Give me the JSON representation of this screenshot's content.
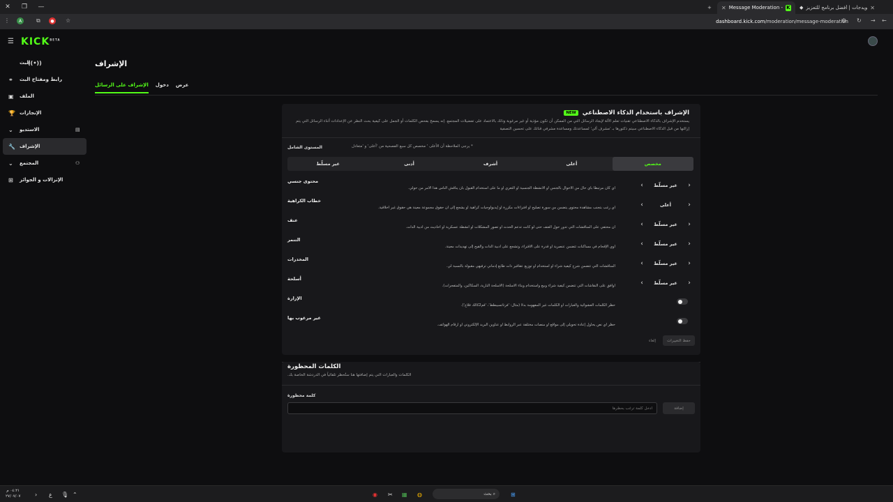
{
  "browser": {
    "tabs": [
      {
        "title": "الويدجات | أفضل برنامج للتعزيز ..."
      },
      {
        "title": "Message Moderation - Kick Da..."
      }
    ],
    "new_tab": "+",
    "url_host": "dashboard.kick.com",
    "url_path": "/moderation/message-moderation"
  },
  "app": {
    "logo": "KICK",
    "logo_sup": "BETA"
  },
  "sidebar": {
    "items": [
      {
        "label": "البث",
        "icon": "live-icon"
      },
      {
        "label": "رابط ومفتاح البث",
        "icon": "link-icon"
      },
      {
        "label": "الملف",
        "icon": "profile-icon"
      },
      {
        "label": "الإنجازات",
        "icon": "trophy-icon"
      },
      {
        "label": "الاستديو",
        "icon": "studio-icon"
      },
      {
        "label": "الإشراف",
        "icon": "shield-icon"
      },
      {
        "label": "المجتمع",
        "icon": "community-icon"
      },
      {
        "label": "الإنزالات و الجوائز",
        "icon": "gift-icon"
      }
    ]
  },
  "page": {
    "title": "الإشراف",
    "tabs": [
      "الإشراف على الرسائل",
      "دخول",
      "عرض"
    ]
  },
  "ai_card": {
    "title": "الإشراف باستخدام الذكاء الاصطناعي",
    "badge": "NEW",
    "description": "يستخدم الإشراف بالذكاء الاصطناعي تقنيات تعلم الآلة لإيجاد الرسائل التي من الممكن أن تكون مؤذية أو غير مرغوبة وذلك بالاعتماد على تفضيلات المجتمع. إنه يسمح بفحص الكلمات أو الجمل على كيفية بحث النظر عن الإعدادات أثناء الرسائل التي يتم إزالتها من قبل الذكاء الاصطناعي سيتم ذكتورها بـ 'مشرف آلي' لمساعدتك ومساعدة مشرفي قناتك على تحسين التصفية",
    "level_label": "المستوى الشامل",
    "level_note": "* يرجى الملاحظة أن الأعلى ' مخصص كل سبع الفصحية من 'أعلى' و 'متعادل",
    "levels": [
      "مخصص",
      "أعلى",
      "أشرف",
      "أدنى",
      "غير مسلّط"
    ],
    "categories": [
      {
        "name": "محتوى جنسي",
        "desc": "أي كان مرتبطاً بأي حال من الأحوال بالجنس أو الأنشطة الجنسية أو التعري أو ما على استخدام القبول بأن يناقش الناس هذا الأمر من حولي.",
        "value": "غير مسلّط"
      },
      {
        "name": "خطاب الكراهية",
        "desc": "أي رغب بتجنب مشاهدة محتوى يتضمن من سورة تصليح أو افتراءات مكررة أو إيديولوجيات كراهية أو يشجع إلى أن حقوق مجموعة معينة هي حقوق غير أخلاقية.",
        "value": "أعلى"
      },
      {
        "name": "عنف",
        "desc": "أن محتفي على المناقشات التي تدور حول العنف حتى لو كانت تدعم الحدث أو تصور المشكلات أو أنشطة عسكرية أو أحاديث من أدبية الذات.",
        "value": "غير مسلّط"
      },
      {
        "name": "التنمر",
        "desc": "أوي الإقحام في مساكنات تتضمن عنصرية أو قدرة على الاقتراء، وتشجع على أدبية الذات والقيح إلى تهديدات معينة.",
        "value": "غير مسلّط"
      },
      {
        "name": "المخدرات",
        "desc": "المناقشات التي تتضمن شرح كيفية شراء أو استخدام أو توزيع عقاقير ذات طابع إدماني ترفيهي مقبولة بالنسبة لي.",
        "value": "غير مسلّط"
      },
      {
        "name": "أسلحة",
        "desc": "أوافق على النقاشات التي تتضمن كيفية شراء وبيع واستخدام وبناء الأسلحة (الأسلحة النارية، السكاكين، والمتفجرات).",
        "value": "غير مسلّط"
      }
    ],
    "toggles": [
      {
        "name": "الإزارة",
        "desc": "حظر الكلمات العشوائية والعبارات أو الكلمات غير المفهومة بدلاً (مثال: 'فرتاتسيبطط'، 'قم2كالك فلاج')."
      },
      {
        "name": "غير مرغوب بها",
        "desc": "حظر أي نص يحاول إعادة تحويلي إلى مواقع أو منصات مختلفة عبر الروابط أو عناوين البريد الإلكتروني أو أرقام الهواتف."
      }
    ],
    "save_label": "حفظ التغييرات",
    "cancel_label": "إلغاء"
  },
  "banned_card": {
    "title": "الكلمات المحظورة",
    "description": "الكلمات والعبارات التي يتم إضافتها هنا ستُحظر تلقائياً في الدردشة الخاصة بك.",
    "input_label": "كلمة محظورة",
    "input_placeholder": "أدخل كلمة ترغب بحظرها",
    "add_label": "إضافة"
  },
  "taskbar": {
    "search_label": "بحث",
    "time": "٠٤:٢١ م",
    "date": "٢٧/٠٧/٠٧",
    "lang": "ع"
  },
  "colors": {
    "accent": "#53fc18",
    "background": "#0e0e10",
    "card": "#18181b"
  }
}
